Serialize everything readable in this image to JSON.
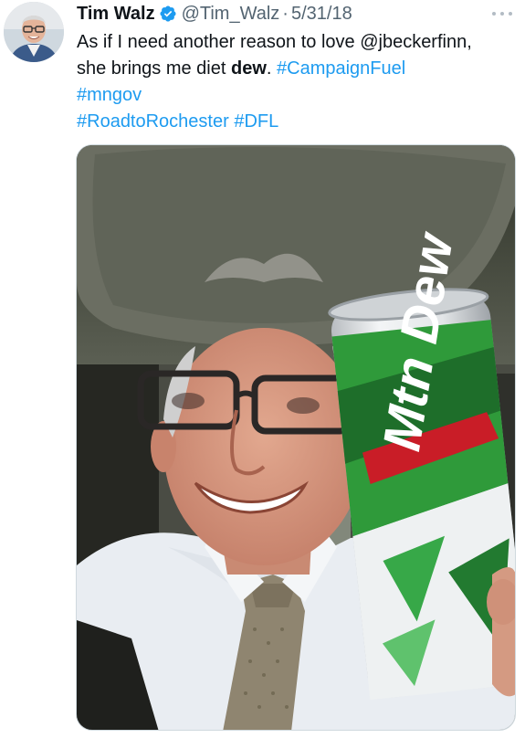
{
  "tweet": {
    "author": {
      "display_name": "Tim Walz",
      "handle": "@Tim_Walz",
      "verified": true
    },
    "separator": "·",
    "date": "5/31/18",
    "text": {
      "line1": "As if I need another reason to love @jbeckerfinn,",
      "line2_prefix": "she brings me diet ",
      "line2_bold": "dew",
      "line2_suffix": ". ",
      "hashtags": [
        "#CampaignFuel",
        "#mngov",
        "#RoadtoRochester",
        "#DFL"
      ]
    },
    "media": {
      "can_text": "Mtn Dew"
    }
  },
  "colors": {
    "link": "#1d9bf0",
    "secondary_text": "#536471",
    "verified": "#1d9bf0"
  },
  "icons": [
    "verified-badge-icon",
    "more-options-icon"
  ]
}
